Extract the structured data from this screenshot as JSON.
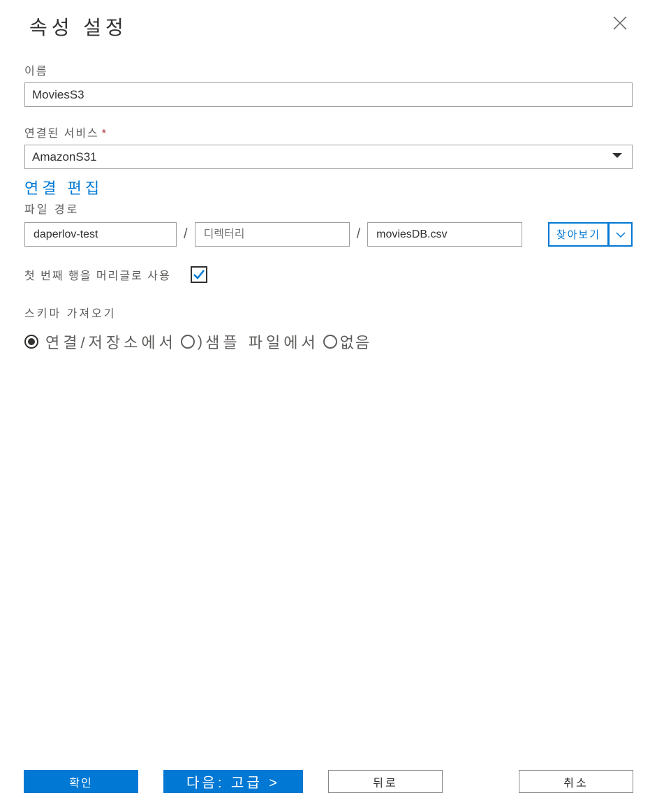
{
  "dialog": {
    "title": "속성 설정"
  },
  "fields": {
    "name_label": "이름",
    "name_value": "MoviesS3",
    "linked_service_label": "연결된 서비스",
    "linked_service_value": "AmazonS31",
    "edit_connection_link": "연결 편집",
    "file_path_label": "파일 경로",
    "path_container": "daperlov-test",
    "path_directory_placeholder": "디렉터리",
    "path_file": "moviesDB.csv",
    "browse_label": "찾아보기",
    "first_row_header_label": "첫 번째 행을 머리글로 사용",
    "first_row_header_checked": true,
    "import_schema_label": "스키마 가져오기",
    "schema_options": {
      "from_connection": "연결/저장소에서",
      "from_sample": "샘플 파일에서",
      "none": "없음"
    },
    "schema_selected": "from_connection"
  },
  "footer": {
    "ok": "확인",
    "next": "다음: 고급 >",
    "back": "뒤로",
    "cancel": "취소"
  }
}
